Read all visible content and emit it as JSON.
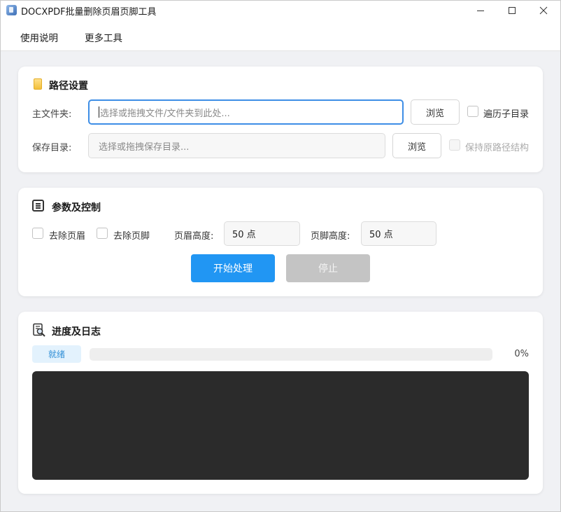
{
  "window": {
    "title": "DOCXPDF批量删除页眉页脚工具",
    "icon": "app-icon"
  },
  "menu": {
    "items": [
      "使用说明",
      "更多工具"
    ]
  },
  "path_settings": {
    "title": "路径设置",
    "icon": "folder-icon",
    "main_folder": {
      "label": "主文件夹:",
      "placeholder": "选择或拖拽文件/文件夹到此处...",
      "browse_label": "浏览",
      "checkbox_label": "遍历子目录",
      "checked": false
    },
    "save_dir": {
      "label": "保存目录:",
      "placeholder": "选择或拖拽保存目录...",
      "browse_label": "浏览",
      "checkbox_label": "保持原路径结构",
      "checked": false,
      "disabled": true
    }
  },
  "params": {
    "title": "参数及控制",
    "icon": "document-list-icon",
    "remove_header": {
      "label": "去除页眉",
      "checked": false
    },
    "remove_footer": {
      "label": "去除页脚",
      "checked": false
    },
    "header_height": {
      "label": "页眉高度:",
      "value": "50 点"
    },
    "footer_height": {
      "label": "页脚高度:",
      "value": "50 点"
    },
    "start_label": "开始处理",
    "stop_label": "停止"
  },
  "progress": {
    "title": "进度及日志",
    "icon": "document-search-icon",
    "status": "就绪",
    "percent": 0,
    "percent_text": "0%",
    "log_text": ""
  },
  "colors": {
    "accent": "#2196f3",
    "disabled_button": "#c4c4c4",
    "log_background": "#2b2b2b",
    "status_badge_bg": "#e3f2fd"
  }
}
